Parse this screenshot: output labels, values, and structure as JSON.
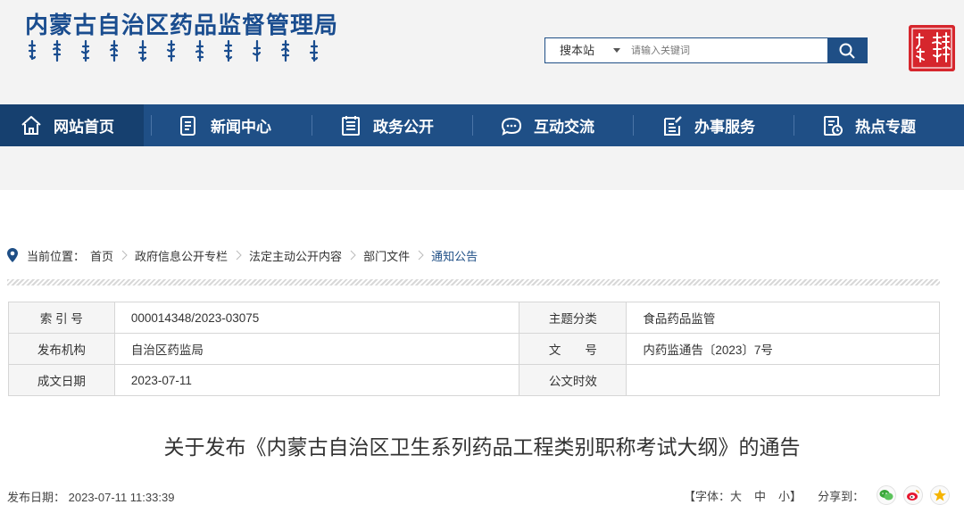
{
  "header": {
    "site_title": "内蒙古自治区药品监督管理局",
    "search": {
      "scope_label": "搜本站",
      "placeholder": "请输入关键词"
    }
  },
  "nav": {
    "items": [
      {
        "label": "网站首页",
        "icon": "home-icon",
        "active": true
      },
      {
        "label": "新闻中心",
        "icon": "news-icon"
      },
      {
        "label": "政务公开",
        "icon": "government-affairs-icon"
      },
      {
        "label": "互动交流",
        "icon": "chat-icon"
      },
      {
        "label": "办事服务",
        "icon": "service-icon"
      },
      {
        "label": "热点专题",
        "icon": "topics-icon"
      }
    ]
  },
  "breadcrumb": {
    "prefix": "当前位置：",
    "items": [
      "首页",
      "政府信息公开专栏",
      "法定主动公开内容",
      "部门文件",
      "通知公告"
    ]
  },
  "info": {
    "index_no_label": "索 引 号",
    "index_no": "000014348/2023-03075",
    "subject_label": "主题分类",
    "subject": "食品药品监管",
    "issuer_label": "发布机构",
    "issuer": "自治区药监局",
    "doc_no_label": "文　　号",
    "doc_no": "内药监通告〔2023〕7号",
    "date_label": "成文日期",
    "date": "2023-07-11",
    "validity_label": "公文时效",
    "validity": ""
  },
  "article": {
    "title": "关于发布《内蒙古自治区卫生系列药品工程类别职称考试大纲》的通告",
    "pub_label": "发布日期：",
    "pub_datetime": "2023-07-11 11:33:39"
  },
  "tools": {
    "font_prefix": "【字体：",
    "size_large": "大",
    "size_medium": "中",
    "size_small": "小】",
    "share_label": "分享到："
  },
  "colors": {
    "primary": "#1f4f86",
    "nav_active": "#16406f",
    "seal": "#d6262d"
  }
}
